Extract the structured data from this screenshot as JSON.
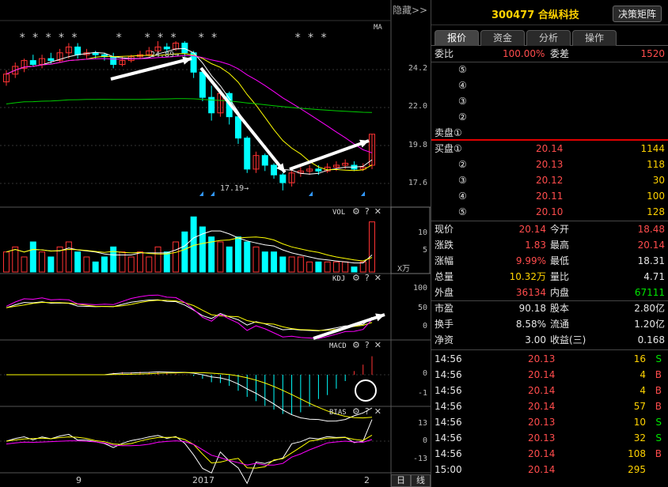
{
  "chart": {
    "hide_label": "隐藏>>",
    "ma_label": "MA",
    "stars_group1": "*****",
    "stars_group2": "*",
    "stars_group3": "***",
    "stars_group4": "**",
    "stars_group5": "***",
    "high_note": "24.89→",
    "low_note": "17.19→",
    "price_axis": [
      "24.2",
      "22.0",
      "19.8",
      "17.6"
    ],
    "vol_label": "VOL",
    "vol_axis": [
      "10",
      "5"
    ],
    "vol_unit": "X万",
    "kdj_label": "KDJ",
    "kdj_axis": [
      "100",
      "50",
      "0"
    ],
    "macd_label": "MACD",
    "macd_axis": [
      "0",
      "-1"
    ],
    "bias_label": "BIAS",
    "bias_axis": [
      "13",
      "0",
      "-13"
    ],
    "tool_gear": "⚙",
    "tool_help": "?",
    "tool_close": "✕",
    "dates": [
      "9",
      "2017",
      "2"
    ],
    "period_day": "日",
    "period_line": "线",
    "colors": {
      "up": "#ff3333",
      "down": "#00ffff",
      "ma5": "#ffffff",
      "ma10": "#ffff00",
      "ma20": "#ff00ff",
      "ma60": "#00cc00"
    }
  },
  "quote": {
    "stock_code": "300477",
    "stock_name": "合纵科技",
    "stock_title": "300477 合纵科技",
    "decision_btn": "决策矩阵",
    "tabs": [
      "报价",
      "资金",
      "分析",
      "操作"
    ],
    "wei_bi_label": "委比",
    "wei_bi_value": "100.00%",
    "wei_cha_label": "委差",
    "wei_cha_value": "1520",
    "sell_levels": [
      {
        "label": "⑤",
        "price": "",
        "vol": ""
      },
      {
        "label": "④",
        "price": "",
        "vol": ""
      },
      {
        "label": "③",
        "price": "",
        "vol": ""
      },
      {
        "label": "②",
        "price": "",
        "vol": ""
      },
      {
        "label": "卖盘①",
        "price": "",
        "vol": ""
      }
    ],
    "buy_levels": [
      {
        "label": "买盘①",
        "price": "20.14",
        "vol": "1144"
      },
      {
        "label": "②",
        "price": "20.13",
        "vol": "118"
      },
      {
        "label": "③",
        "price": "20.12",
        "vol": "30"
      },
      {
        "label": "④",
        "price": "20.11",
        "vol": "100"
      },
      {
        "label": "⑤",
        "price": "20.10",
        "vol": "128"
      }
    ],
    "stats": [
      {
        "l1": "现价",
        "v1": "20.14",
        "c1": "red",
        "l2": "今开",
        "v2": "18.48",
        "c2": "red"
      },
      {
        "l1": "涨跌",
        "v1": "1.83",
        "c1": "red",
        "l2": "最高",
        "v2": "20.14",
        "c2": "red"
      },
      {
        "l1": "涨幅",
        "v1": "9.99%",
        "c1": "red",
        "l2": "最低",
        "v2": "18.31",
        "c2": "white"
      },
      {
        "l1": "总量",
        "v1": "10.32万",
        "c1": "yellow",
        "l2": "量比",
        "v2": "4.71",
        "c2": "white"
      },
      {
        "l1": "外盘",
        "v1": "36134",
        "c1": "red",
        "l2": "内盘",
        "v2": "67111",
        "c2": "green"
      }
    ],
    "fundamentals": [
      {
        "l1": "市盈",
        "v1": "90.18",
        "l2": "股本",
        "v2": "2.80亿"
      },
      {
        "l1": "换手",
        "v1": "8.58%",
        "l2": "流通",
        "v2": "1.20亿"
      },
      {
        "l1": "净资",
        "v1": "3.00",
        "l2": "收益(三)",
        "v2": "0.168"
      }
    ],
    "ticks": [
      {
        "time": "14:56",
        "price": "20.13",
        "vol": "16",
        "side": "S"
      },
      {
        "time": "14:56",
        "price": "20.14",
        "vol": "4",
        "side": "B"
      },
      {
        "time": "14:56",
        "price": "20.14",
        "vol": "4",
        "side": "B"
      },
      {
        "time": "14:56",
        "price": "20.14",
        "vol": "57",
        "side": "B"
      },
      {
        "time": "14:56",
        "price": "20.13",
        "vol": "10",
        "side": "S"
      },
      {
        "time": "14:56",
        "price": "20.13",
        "vol": "32",
        "side": "S"
      },
      {
        "time": "14:56",
        "price": "20.14",
        "vol": "108",
        "side": "B"
      },
      {
        "time": "15:00",
        "price": "20.14",
        "vol": "295",
        "side": ""
      }
    ]
  }
}
